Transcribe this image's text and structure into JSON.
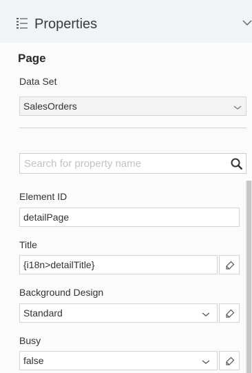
{
  "header": {
    "title": "Properties",
    "icon": "properties-list-icon",
    "collapse_icon": "chevron-down-icon"
  },
  "section": {
    "title": "Page"
  },
  "data_set": {
    "label": "Data Set",
    "value": "SalesOrders"
  },
  "search": {
    "placeholder": "Search for property name",
    "icon": "search-icon"
  },
  "properties": {
    "element_id": {
      "label": "Element ID",
      "value": "detailPage"
    },
    "title": {
      "label": "Title",
      "value": "{i18n>detailTitle}",
      "icon": "data-binding-icon"
    },
    "background_design": {
      "label": "Background Design",
      "value": "Standard",
      "icon": "data-binding-icon"
    },
    "busy": {
      "label": "Busy",
      "value": "false",
      "icon": "data-binding-icon"
    }
  },
  "colors": {
    "header_bg": "#eff4f9",
    "panel_bg": "#fafbfc",
    "border": "#d4d4d4",
    "placeholder": "#c2c2c2"
  }
}
